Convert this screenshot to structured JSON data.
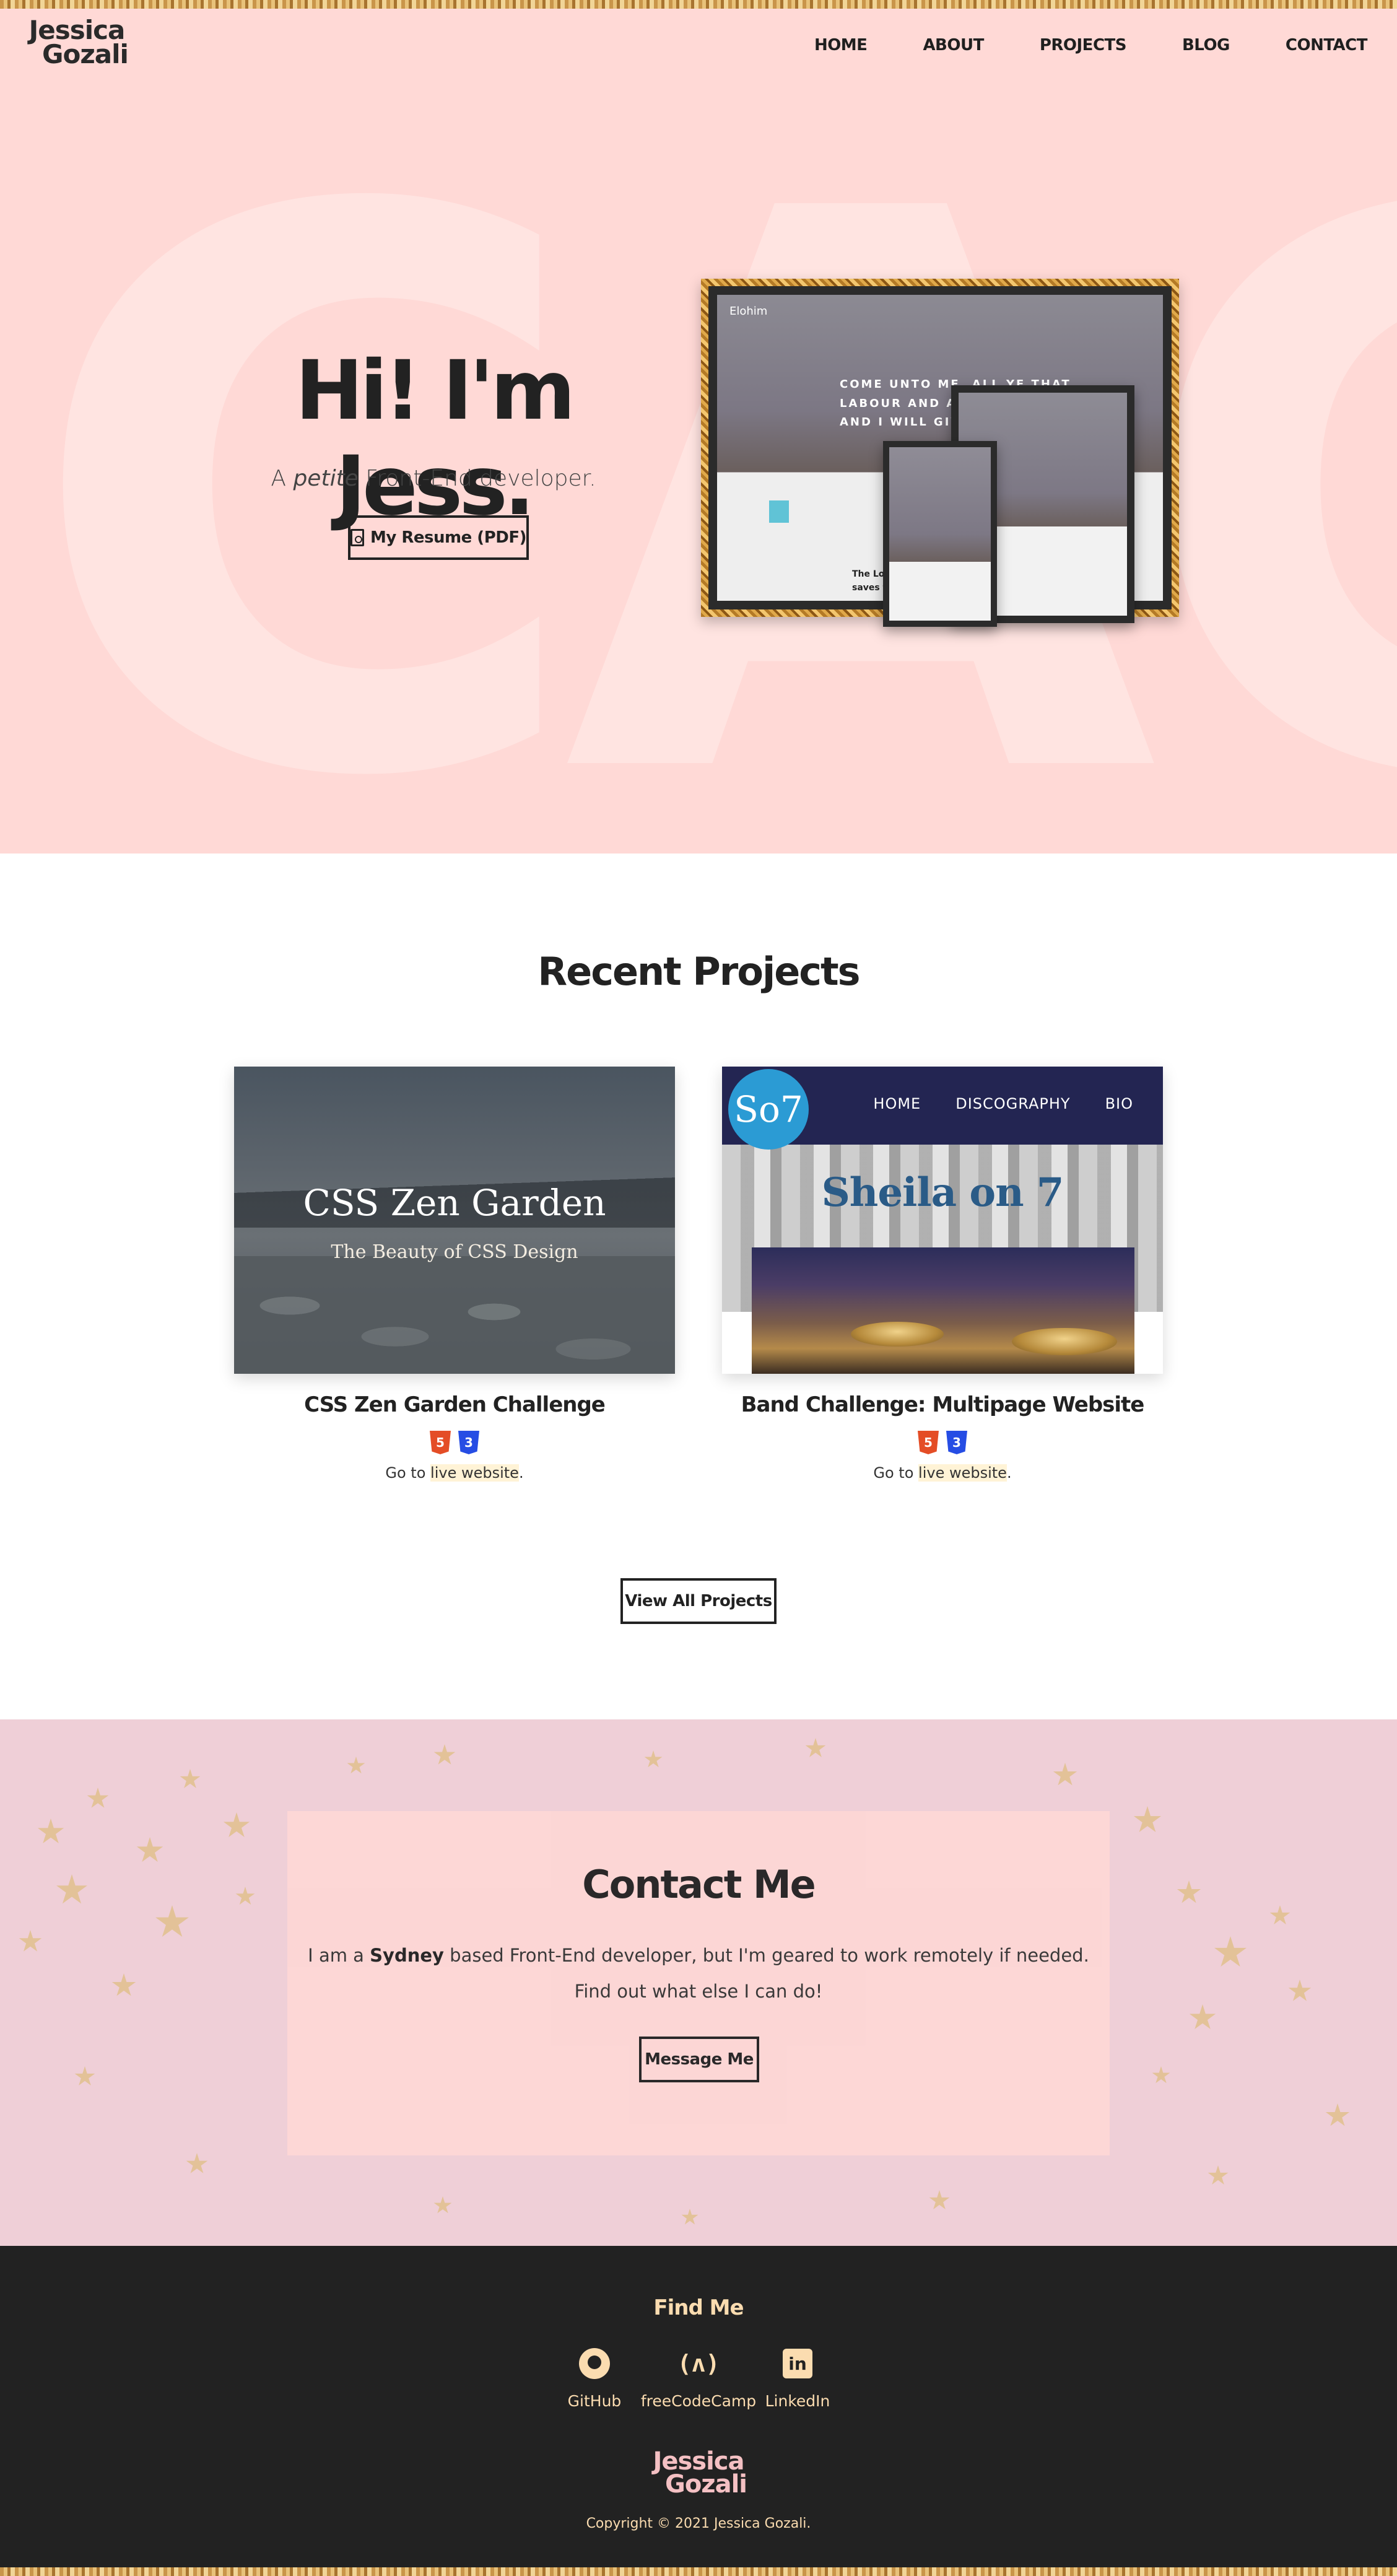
{
  "site": {
    "logo_line1": "Jessica",
    "logo_line2": "Gozali"
  },
  "nav": {
    "items": [
      "HOME",
      "ABOUT",
      "PROJECTS",
      "BLOG",
      "CONTACT"
    ]
  },
  "hero": {
    "background_text": "CAGC",
    "title": "Hi! I'm Jess.",
    "subtitle_prefix": "A ",
    "subtitle_em": "petite",
    "subtitle_suffix": " Front-End developer.",
    "resume_button": "My Resume (PDF)",
    "mockup": {
      "brand": "Elohim",
      "headline": [
        "COME UNTO ME, ALL YE THAT",
        "LABOUR AND ARE H",
        "AND I WILL GIVE YO"
      ],
      "footer_text": [
        "The Lord",
        "saves th"
      ]
    }
  },
  "projects": {
    "section_title": "Recent Projects",
    "items": [
      {
        "title": "CSS Zen Garden Challenge",
        "thumb_title": "CSS Zen Garden",
        "thumb_subtitle": "The Beauty of CSS Design",
        "link_prefix": "Go to ",
        "link_text": "live website",
        "link_suffix": "."
      },
      {
        "title": "Band Challenge: Multipage Website",
        "thumb_logo": "So7",
        "thumb_nav": [
          "HOME",
          "DISCOGRAPHY",
          "BIO"
        ],
        "thumb_title": "Sheila on 7",
        "link_prefix": "Go to ",
        "link_text": "live website",
        "link_suffix": "."
      }
    ],
    "view_all_button": "View All Projects"
  },
  "contact": {
    "title": "Contact Me",
    "line1_prefix": "I am a ",
    "line1_bold": "Sydney",
    "line1_suffix": " based Front-End developer, but I'm geared to work remotely if needed.",
    "line2": "Find out what else I can do!",
    "button": "Message Me"
  },
  "footer": {
    "find_me": "Find Me",
    "links": [
      {
        "label": "GitHub",
        "icon": "github-icon"
      },
      {
        "label": "freeCodeCamp",
        "icon": "freecodecamp-icon"
      },
      {
        "label": "LinkedIn",
        "icon": "linkedin-icon"
      }
    ],
    "logo_line1": "Jessica",
    "logo_line2": "Gozali",
    "copyright": "Copyright © 2021 Jessica Gozali."
  },
  "colors": {
    "hero_bg": "#ffd9d6",
    "footer_bg": "#222222",
    "footer_accent": "#fbdcb0",
    "contact_bg": "#efcfd7"
  }
}
